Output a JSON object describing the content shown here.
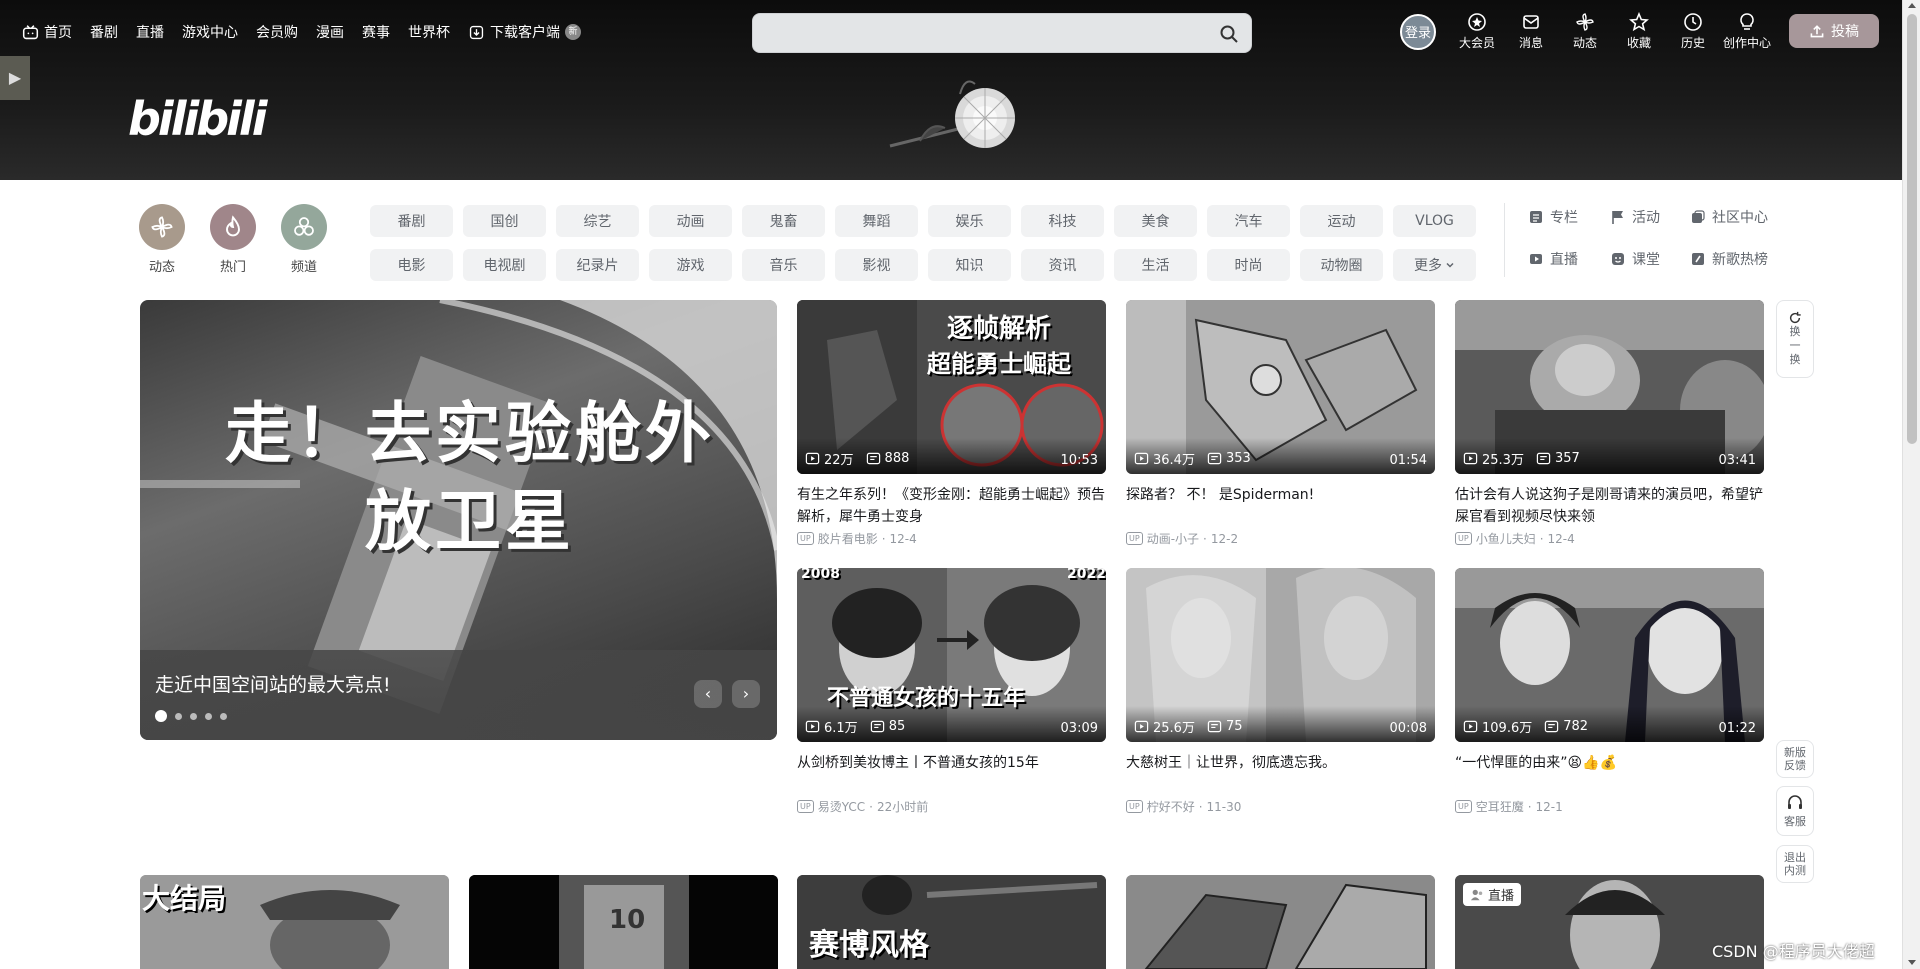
{
  "nav": {
    "items": [
      "首页",
      "番剧",
      "直播",
      "游戏中心",
      "会员购",
      "漫画",
      "赛事",
      "世界杯",
      "下载客户端"
    ],
    "new_badge": "新",
    "search_placeholder": "",
    "login": "登录",
    "right_items": [
      "大会员",
      "消息",
      "动态",
      "收藏",
      "历史",
      "创作中心"
    ],
    "upload": "投稿"
  },
  "logo": "bilibili",
  "channels": {
    "icons": [
      {
        "label": "动态",
        "color": "#a89a8c"
      },
      {
        "label": "热门",
        "color": "#a0868a"
      },
      {
        "label": "频道",
        "color": "#94a79b"
      }
    ],
    "categories": [
      "番剧",
      "国创",
      "综艺",
      "动画",
      "鬼畜",
      "舞蹈",
      "娱乐",
      "科技",
      "美食",
      "汽车",
      "运动",
      "VLOG",
      "电影",
      "电视剧",
      "纪录片",
      "游戏",
      "音乐",
      "影视",
      "知识",
      "资讯",
      "生活",
      "时尚",
      "动物圈",
      "更多"
    ],
    "links": [
      "专栏",
      "活动",
      "社区中心",
      "直播",
      "课堂",
      "新歌热榜"
    ]
  },
  "carousel": {
    "headline_line1": "走！去实验舱外",
    "headline_line2": "放卫星",
    "caption": "走近中国空间站的最大亮点!",
    "prev": "‹",
    "next": "›"
  },
  "videos": [
    {
      "views": "22万",
      "danmaku": "888",
      "duration": "10:53",
      "title": "有生之年系列！《变形金刚：超能勇士崛起》预告解析，犀牛勇士变身",
      "author": "胶片看电影",
      "date": "12-4",
      "overlay1": "逐帧解析",
      "overlay2": "超能勇士崛起"
    },
    {
      "views": "36.4万",
      "danmaku": "353",
      "duration": "01:54",
      "title": "探路者？ 不！ 是Spiderman!",
      "author": "动画-小子",
      "date": "12-2"
    },
    {
      "views": "25.3万",
      "danmaku": "357",
      "duration": "03:41",
      "title": "估计会有人说这狗子是刚哥请来的演员吧，希望铲屎官看到视频尽快来领",
      "author": "小鱼儿夫妇",
      "date": "12-4"
    },
    {
      "views": "6.1万",
      "danmaku": "85",
      "duration": "03:09",
      "title": "从剑桥到美妆博主丨不普通女孩的15年",
      "author": "易烫YCC",
      "date": "22小时前",
      "overlay1": "不普通女孩的十五年",
      "year1": "2008",
      "year2": "2022"
    },
    {
      "views": "25.6万",
      "danmaku": "75",
      "duration": "00:08",
      "title": "大慈树王｜让世界，彻底遗忘我。",
      "author": "柠好不好",
      "date": "11-30"
    },
    {
      "views": "109.6万",
      "danmaku": "782",
      "duration": "01:22",
      "title": "“一代悍匪的由来”😫👍💰",
      "author": "空耳狂魔",
      "date": "12-1"
    }
  ],
  "bottom_row": [
    {
      "overlay": "大结局"
    },
    {
      "overlay": "10"
    },
    {
      "overlay": "赛博风格"
    },
    {
      "overlay": ""
    },
    {
      "overlay": "直播"
    }
  ],
  "float": {
    "refresh": "换一换",
    "feedback": "新版反馈",
    "service": "客服",
    "exit": "退出内测"
  },
  "watermark": "CSDN @程序员大佬超",
  "up_tag": "UP"
}
